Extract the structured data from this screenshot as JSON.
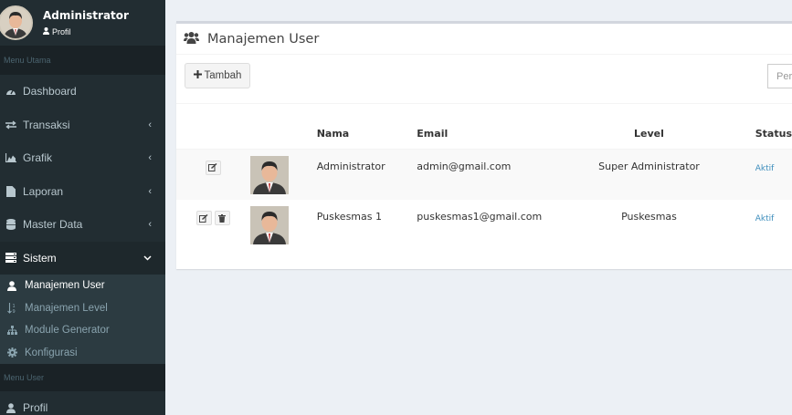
{
  "sidebar": {
    "user_name": "Administrator",
    "user_link": "Profil",
    "header_main": "Menu Utama",
    "items": [
      {
        "label": "Dashboard",
        "icon": "dashboard-icon"
      },
      {
        "label": "Transaksi",
        "icon": "exchange-icon"
      },
      {
        "label": "Grafik",
        "icon": "area-chart-icon"
      },
      {
        "label": "Laporan",
        "icon": "file-icon"
      },
      {
        "label": "Master Data",
        "icon": "database-icon"
      },
      {
        "label": "Sistem",
        "icon": "server-icon"
      }
    ],
    "submenu": [
      {
        "label": "Manajemen User",
        "icon": "user-icon"
      },
      {
        "label": "Manajemen Level",
        "icon": "sort-numeric-icon"
      },
      {
        "label": "Module Generator",
        "icon": "sitemap-icon"
      },
      {
        "label": "Konfigurasi",
        "icon": "gear-icon"
      }
    ],
    "header_user": "Menu User",
    "profil_label": "Profil"
  },
  "main": {
    "title": "Manajemen User",
    "add_label": "Tambah",
    "search_placeholder": "Per",
    "columns": [
      "",
      "",
      "Nama",
      "Email",
      "Level",
      "Status"
    ],
    "rows": [
      {
        "nama": "Administrator",
        "email": "admin@gmail.com",
        "level": "Super Administrator",
        "status": "Aktif"
      },
      {
        "nama": "Puskesmas 1",
        "email": "puskesmas1@gmail.com",
        "level": "Puskesmas",
        "status": "Aktif"
      }
    ]
  },
  "colors": {
    "sidebar_bg": "#222d32",
    "sidebar_header": "#1a2226",
    "submenu_bg": "#2c3b41",
    "body_bg": "#ecf0f5",
    "link": "#3c8dbc"
  }
}
